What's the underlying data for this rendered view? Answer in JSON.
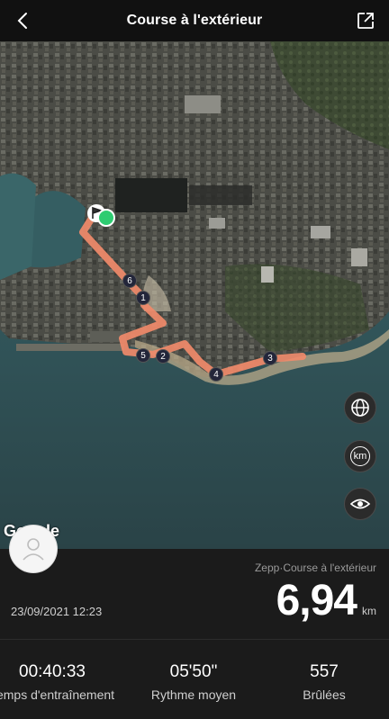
{
  "header": {
    "title": "Course à l'extérieur"
  },
  "map": {
    "attribution": "Google",
    "route_color": "#f08a6a",
    "start_marker_color": "#2ecc71",
    "km_markers": [
      "1",
      "2",
      "3",
      "4",
      "5",
      "6"
    ],
    "controls": [
      {
        "icon": "globe-icon"
      },
      {
        "label": "km"
      },
      {
        "icon": "eye-icon"
      }
    ]
  },
  "summary": {
    "device_label": "Zepp·Course à l'extérieur",
    "distance_value": "6,94",
    "distance_unit": "km",
    "date": "23/09/2021 12:23"
  },
  "stats": [
    {
      "value": "00:40:33",
      "label": "Temps d'entraînement"
    },
    {
      "value": "05'50\"",
      "label": "Rythme moyen"
    },
    {
      "value": "557",
      "label": "Brûlées"
    }
  ]
}
